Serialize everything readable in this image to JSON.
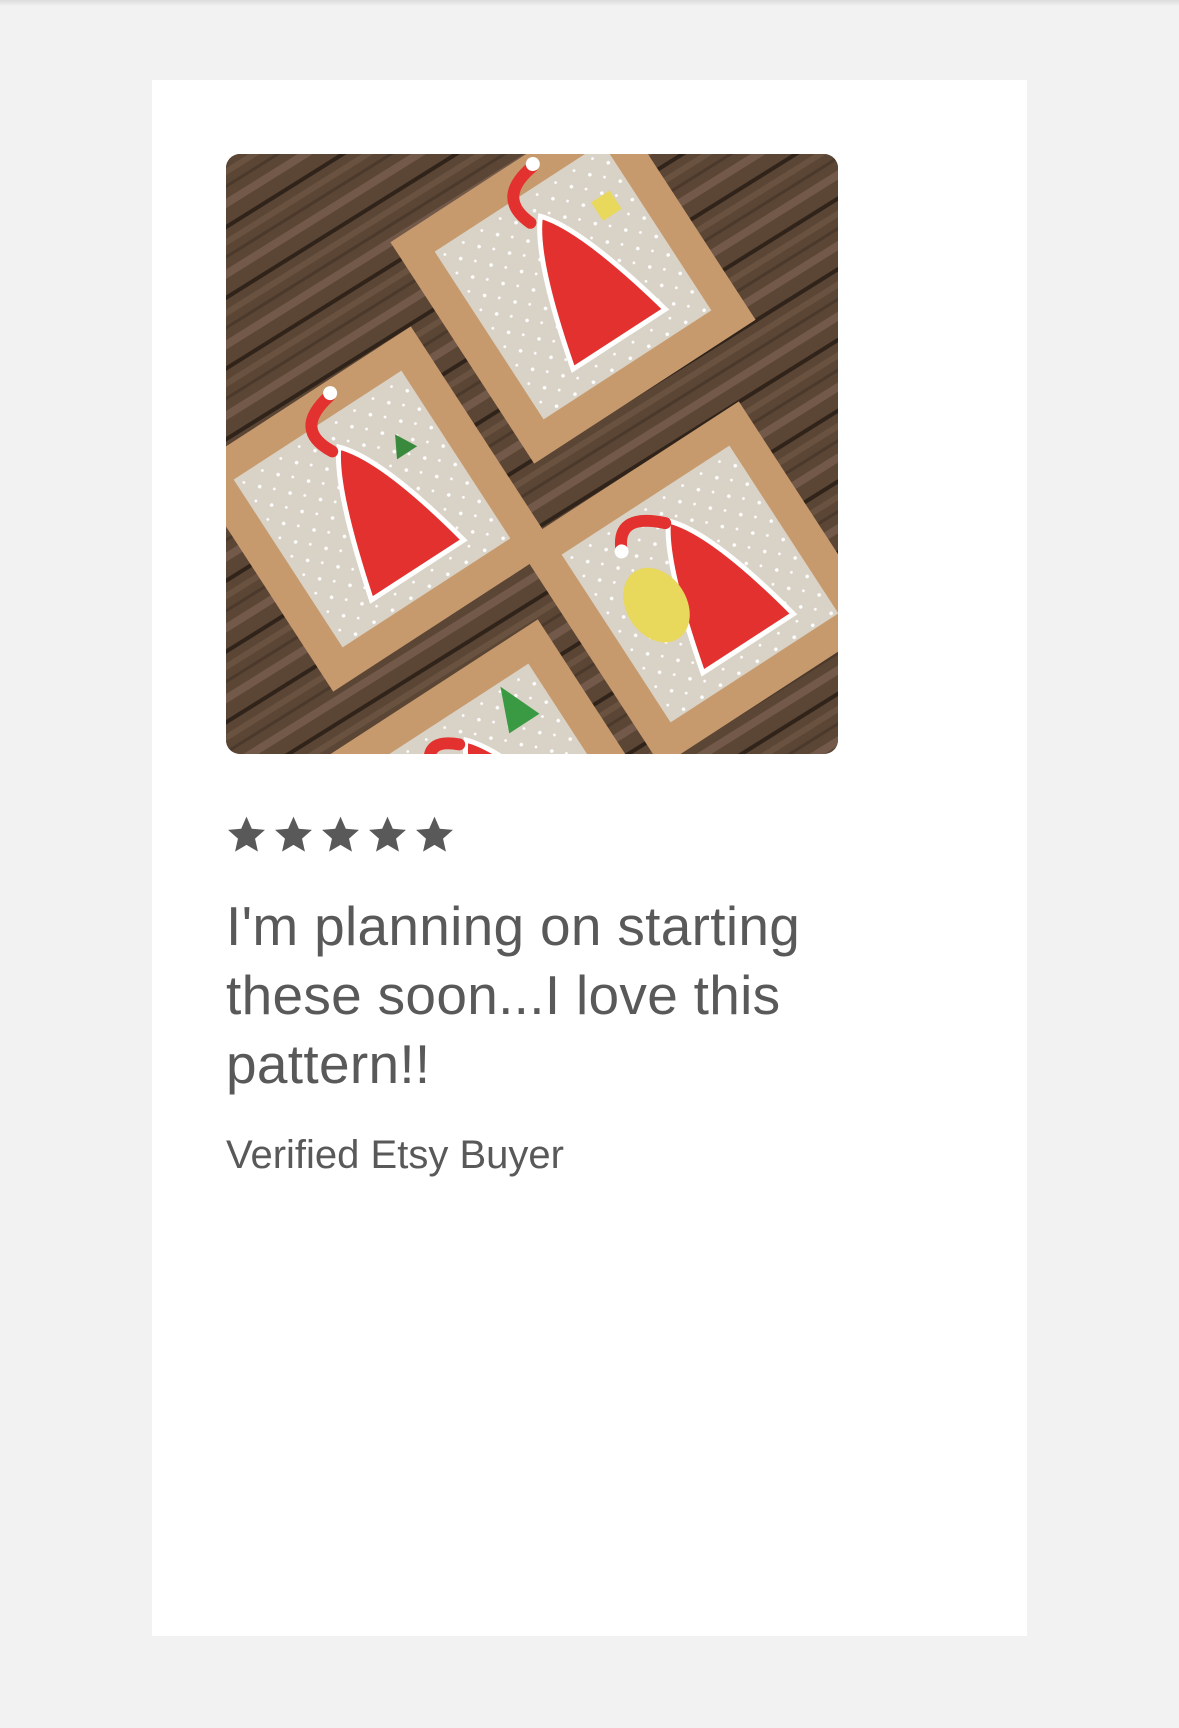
{
  "review": {
    "rating": 5,
    "rating_max": 5,
    "text": "I'm planning on starting these soon...I love this pattern!!",
    "reviewer": "Verified Etsy Buyer",
    "photo_alt": "Four cross-stitched Santa Claus cards on kraft card mounts laid on a wooden table"
  },
  "icons": {
    "star": "star-icon"
  },
  "colors": {
    "page_background": "#f2f2f2",
    "card_background": "#ffffff",
    "text": "#595959",
    "star": "#595959"
  }
}
